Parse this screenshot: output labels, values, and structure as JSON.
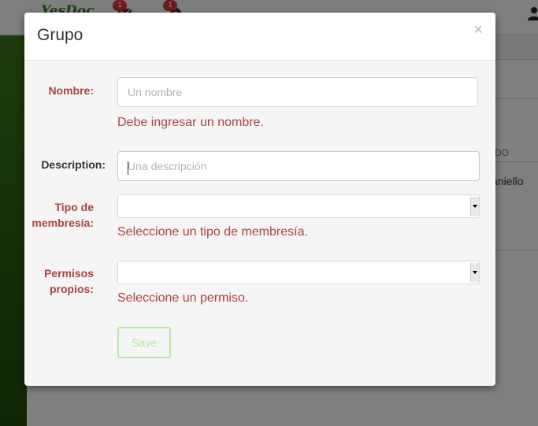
{
  "background": {
    "logo": "YesDoc",
    "nav_badges": [
      "1",
      "1"
    ],
    "column_fragment": "DO",
    "cell_fragment": "aniello"
  },
  "modal": {
    "title": "Grupo",
    "close_symbol": "×",
    "fields": {
      "nombre": {
        "label": "Nombre:",
        "placeholder": "Un nombre",
        "value": "",
        "error": "Debe ingresar un nombre."
      },
      "description": {
        "label": "Description:",
        "placeholder": "Una descripción",
        "value": ""
      },
      "tipo_membresia": {
        "label_line1": "Tipo de",
        "label_line2": "membresía:",
        "selected": "",
        "error": "Seleccione un tipo de membresía."
      },
      "permisos": {
        "label_line1": "Permisos",
        "label_line2": "propios:",
        "selected": "",
        "error": "Seleccione un permiso."
      }
    },
    "save_label": "Save"
  },
  "colors": {
    "error": "#a94442",
    "save_border": "#b9e6a0",
    "brand_green": "#3c7a2a"
  }
}
